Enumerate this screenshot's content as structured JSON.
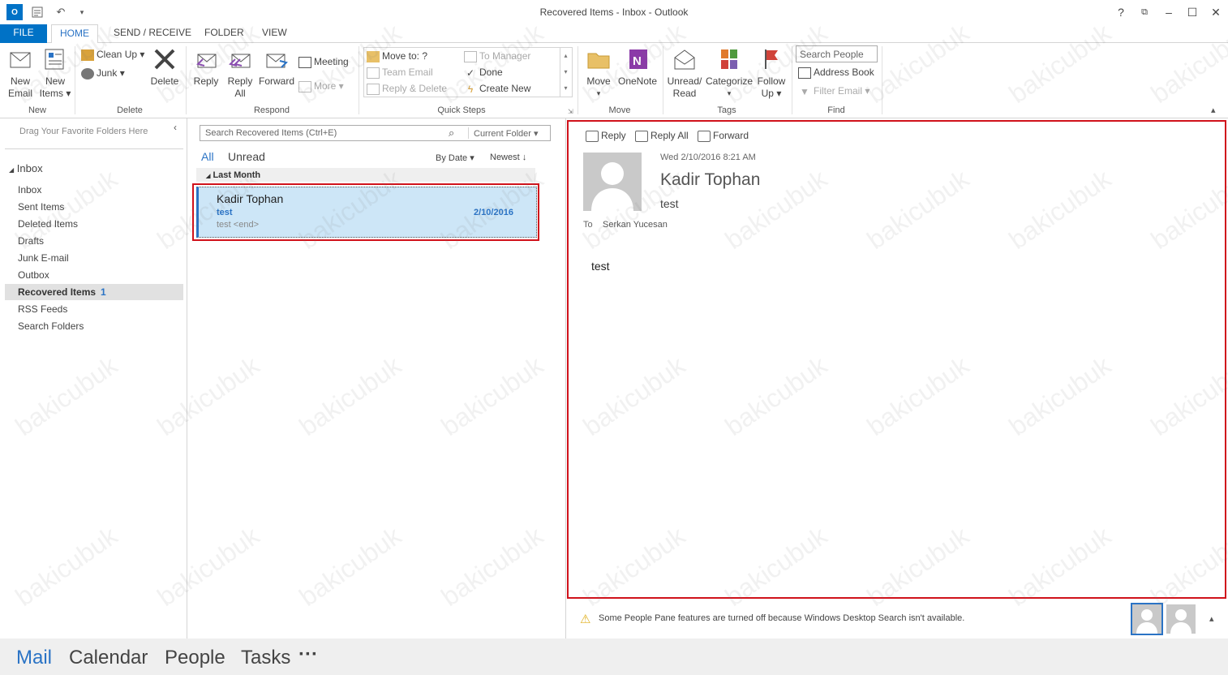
{
  "window": {
    "title": "Recovered Items - Inbox - Outlook"
  },
  "tabs": [
    {
      "label": "FILE"
    },
    {
      "label": "HOME"
    },
    {
      "label": "SEND / RECEIVE"
    },
    {
      "label": "FOLDER"
    },
    {
      "label": "VIEW"
    }
  ],
  "ribbon": {
    "new": {
      "new_email_1": "New",
      "new_email_2": "Email",
      "new_items_1": "New",
      "new_items_2": "Items",
      "group": "New"
    },
    "delete": {
      "cleanup": "Clean Up",
      "junk": "Junk",
      "delete": "Delete",
      "group": "Delete"
    },
    "respond": {
      "reply": "Reply",
      "reply_all_1": "Reply",
      "reply_all_2": "All",
      "forward": "Forward",
      "meeting": "Meeting",
      "more": "More",
      "group": "Respond"
    },
    "quicksteps": {
      "move_to": "Move to: ?",
      "team_email": "Team Email",
      "reply_delete": "Reply & Delete",
      "to_manager": "To Manager",
      "done": "Done",
      "create_new": "Create New",
      "group": "Quick Steps"
    },
    "move": {
      "move": "Move",
      "onenote": "OneNote",
      "group": "Move"
    },
    "tags": {
      "unread_1": "Unread/",
      "unread_2": "Read",
      "categorize": "Categorize",
      "follow_1": "Follow",
      "follow_2": "Up",
      "group": "Tags"
    },
    "find": {
      "search_people": "Search People",
      "address_book": "Address Book",
      "filter_email": "Filter Email",
      "group": "Find"
    }
  },
  "folders": {
    "drag_hint": "Drag Your Favorite Folders Here",
    "root": "Inbox",
    "items": [
      {
        "label": "Inbox"
      },
      {
        "label": "Sent Items"
      },
      {
        "label": "Deleted Items"
      },
      {
        "label": "Drafts"
      },
      {
        "label": "Junk E-mail"
      },
      {
        "label": "Outbox"
      },
      {
        "label": "Recovered Items",
        "count": "1"
      },
      {
        "label": "RSS Feeds"
      },
      {
        "label": "Search Folders"
      }
    ]
  },
  "list": {
    "search_placeholder": "Search Recovered Items (Ctrl+E)",
    "scope": "Current Folder",
    "filter_all": "All",
    "filter_unread": "Unread",
    "sort_by": "By Date",
    "sort_order": "Newest",
    "group_header": "Last Month",
    "messages": [
      {
        "sender": "Kadir Tophan",
        "subject": "test",
        "preview": "test <end>",
        "date": "2/10/2016"
      }
    ]
  },
  "reading": {
    "reply": "Reply",
    "reply_all": "Reply All",
    "forward": "Forward",
    "datetime": "Wed 2/10/2016 8:21 AM",
    "sender": "Kadir Tophan",
    "subject": "test",
    "to_label": "To",
    "to": "Serkan Yucesan",
    "body": "test"
  },
  "people_pane": {
    "notice": "Some People Pane features are turned off because Windows Desktop Search isn't available."
  },
  "nav": [
    {
      "label": "Mail"
    },
    {
      "label": "Calendar"
    },
    {
      "label": "People"
    },
    {
      "label": "Tasks"
    },
    {
      "label": "···"
    }
  ],
  "watermark": "bakicubuk",
  "colors": {
    "accent": "#0072c6",
    "selection": "#cde6f7",
    "highlight_box": "#d0121b"
  }
}
